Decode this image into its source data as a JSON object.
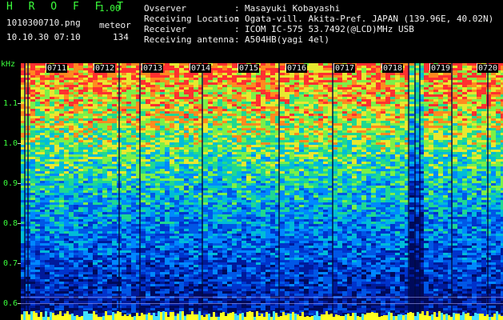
{
  "app": {
    "name": "H R O F F T",
    "version": "1.00"
  },
  "file": {
    "name": "1010300710.png",
    "mode": "meteor",
    "datetime": "10.10.30 07:10",
    "count": "134"
  },
  "info": [
    {
      "label": "Ovserver",
      "value": "Masayuki Kobayashi"
    },
    {
      "label": "Receiving Location",
      "value": "Ogata-vill. Akita-Pref. JAPAN (139.96E, 40.02N)"
    },
    {
      "label": "Receiver",
      "value": "ICOM IC-575 53.7492(@LCD)MHz USB"
    },
    {
      "label": "Receiving antenna",
      "value": "A504HB(yagi 4el)"
    }
  ],
  "info_separator": ":",
  "axis": {
    "unit": "kHz",
    "y_range": [
      0.6,
      1.2
    ],
    "y_ticks": [
      "1.1",
      "1.0",
      "0.9",
      "0.8",
      "0.7",
      "0.6"
    ],
    "time_ticks": [
      "0711",
      "0712",
      "0713",
      "0714",
      "0715",
      "0716",
      "0717",
      "0718",
      "0719",
      "0720"
    ]
  },
  "colors": {
    "label_green": "#3cff3c",
    "text_white": "#f0f0f0",
    "background": "#000000"
  }
}
